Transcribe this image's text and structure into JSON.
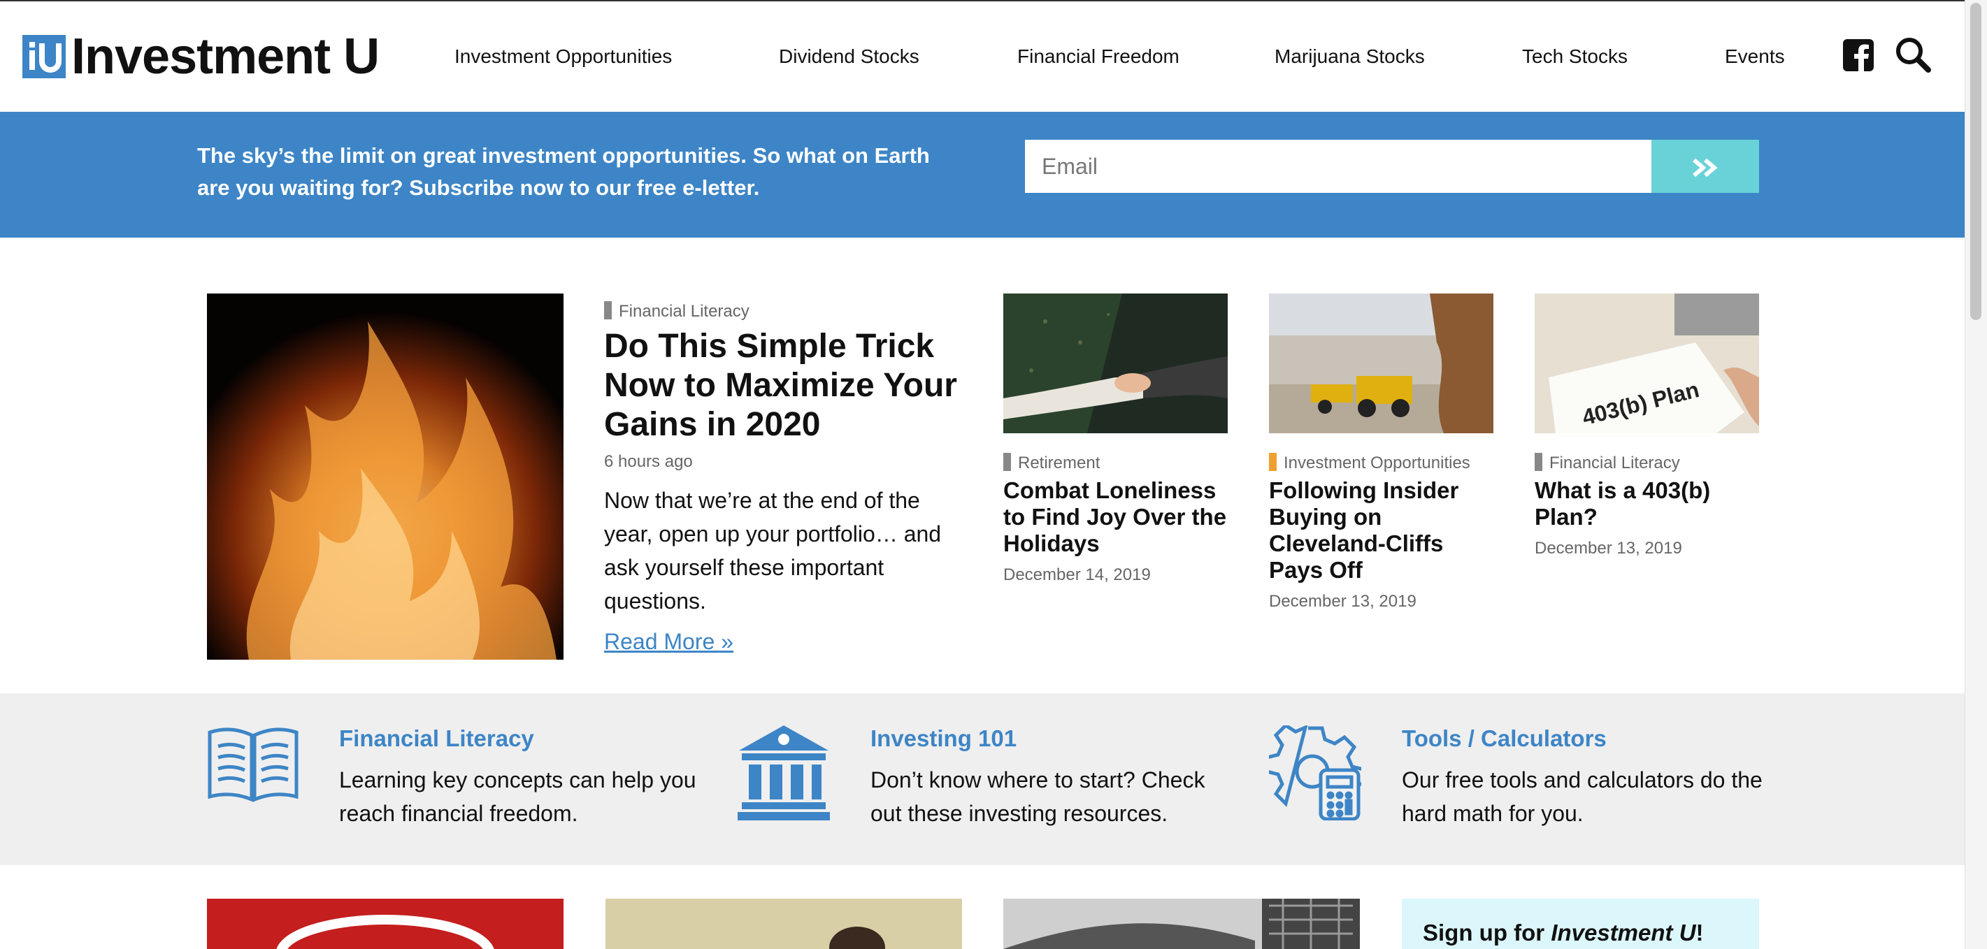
{
  "brand": {
    "name": "Investment U",
    "accent": "#3d85c6",
    "teal": "#69d2d8"
  },
  "nav": {
    "items": [
      "Investment Opportunities",
      "Dividend Stocks",
      "Financial Freedom",
      "Marijuana Stocks",
      "Tech Stocks",
      "Events"
    ],
    "facebook_icon": "facebook-icon",
    "search_icon": "search-icon"
  },
  "banner": {
    "text": "The sky’s the limit on great investment opportunities. So what on Earth are you waiting for? Subscribe now to our free e-letter.",
    "email_placeholder": "Email",
    "submit_icon": "double-chevron-right-icon"
  },
  "featured": {
    "category": "Financial Literacy",
    "title": "Do This Simple Trick Now to Maximize Your Gains in 2020",
    "time": "6 hours ago",
    "excerpt": "Now that we’re at the end of the year, open up your portfolio… and ask yourself these important questions.",
    "read_more": "Read More »"
  },
  "articles": [
    {
      "category": "Retirement",
      "category_color": "#888888",
      "title": "Combat Loneliness to Find Joy Over the Holidays",
      "date": "December 14, 2019"
    },
    {
      "category": "Investment Opportunities",
      "category_color": "#f0a030",
      "title": "Following Insider Buying on Cleveland-Cliffs Pays Off",
      "date": "December 13, 2019"
    },
    {
      "category": "Financial Literacy",
      "category_color": "#888888",
      "title": "What is a 403(b) Plan?",
      "date": "December 13, 2019",
      "image_text": "403(b) Plan"
    }
  ],
  "features": [
    {
      "title": "Financial Literacy",
      "desc": "Learning key concepts can help you reach financial freedom.",
      "icon": "open-book-icon"
    },
    {
      "title": "Investing 101",
      "desc": "Don’t know where to start? Check out these investing resources.",
      "icon": "bank-icon"
    },
    {
      "title": "Tools / Calculators",
      "desc": "Our free tools and calculators do the hard math for you.",
      "icon": "gear-calculator-icon"
    }
  ],
  "signup": {
    "prefix": "Sign up for ",
    "brand": "Investment U",
    "suffix": "!"
  }
}
